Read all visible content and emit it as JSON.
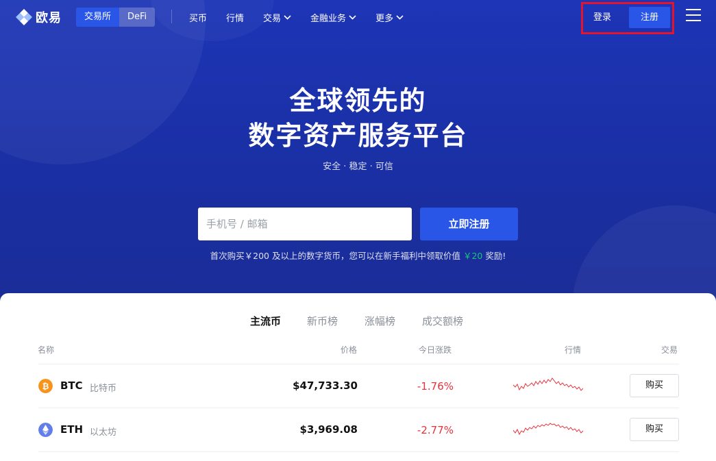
{
  "nav": {
    "logo_text": "欧易",
    "switch": {
      "exchange": "交易所",
      "defi": "DeFi"
    },
    "menu": [
      "买币",
      "行情",
      "交易",
      "金融业务",
      "更多"
    ],
    "login": "登录",
    "register": "注册"
  },
  "hero": {
    "title_line1": "全球领先的",
    "title_line2": "数字资产服务平台",
    "subtitle": "安全 · 稳定 · 可信",
    "input_placeholder": "手机号 / 邮箱",
    "signup_button": "立即注册",
    "promo_prefix": "首次购买￥200 及以上的数字货币，您可以在新手福利中领取价值",
    "promo_amount": "￥20",
    "promo_suffix": "奖励!"
  },
  "market": {
    "tabs": [
      "主流币",
      "新币榜",
      "涨幅榜",
      "成交额榜"
    ],
    "headers": {
      "name": "名称",
      "price": "价格",
      "change": "今日涨跌",
      "chart": "行情",
      "trade": "交易"
    },
    "rows": [
      {
        "symbol": "BTC",
        "name": "比特币",
        "price": "$47,733.30",
        "change": "-1.76%",
        "buy": "购买",
        "icon": "btc-icon",
        "icon_color": "#f7931a"
      },
      {
        "symbol": "ETH",
        "name": "以太坊",
        "price": "$3,969.08",
        "change": "-2.77%",
        "buy": "购买",
        "icon": "eth-icon",
        "icon_color": "#627eea"
      }
    ]
  },
  "colors": {
    "hero_bg": "#1d35b7",
    "accent": "#2a56e8",
    "down": "#e3323a",
    "promo_green": "#17c47a",
    "highlight_border": "#e5142b"
  }
}
